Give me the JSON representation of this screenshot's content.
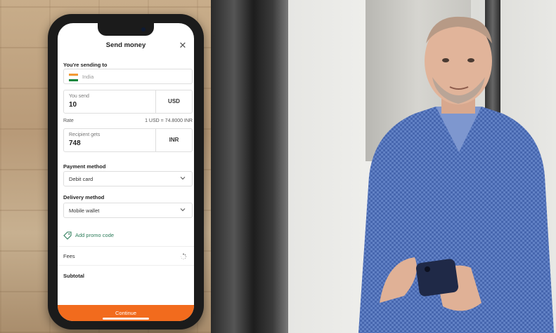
{
  "screen": {
    "title": "Send money",
    "close_icon": "close-icon",
    "sending_to": {
      "label": "You're sending to",
      "country": "India",
      "flag_icon": "india-flag-icon",
      "flag_colors": [
        "#f39a36",
        "#ffffff",
        "#12873d"
      ]
    },
    "you_send": {
      "label": "You send",
      "value": "10",
      "currency": "USD"
    },
    "rate": {
      "label": "Rate",
      "value": "1 USD = 74.8000 INR"
    },
    "recipient_gets": {
      "label": "Recipient gets",
      "value": "748",
      "currency": "INR"
    },
    "payment_method": {
      "label": "Payment method",
      "value": "Debit card",
      "icon": "chevron-down-icon"
    },
    "delivery_method": {
      "label": "Delivery method",
      "value": "Mobile wallet",
      "icon": "chevron-down-icon"
    },
    "promo": {
      "label": "Add promo code",
      "icon": "tag-icon"
    },
    "fees": {
      "label": "Fees",
      "icon": "loading-spinner-icon"
    },
    "subtotal": {
      "label": "Subtotal"
    },
    "continue_label": "Continue"
  },
  "colors": {
    "accent": "#f26b1d",
    "promo": "#2e7d5b"
  }
}
